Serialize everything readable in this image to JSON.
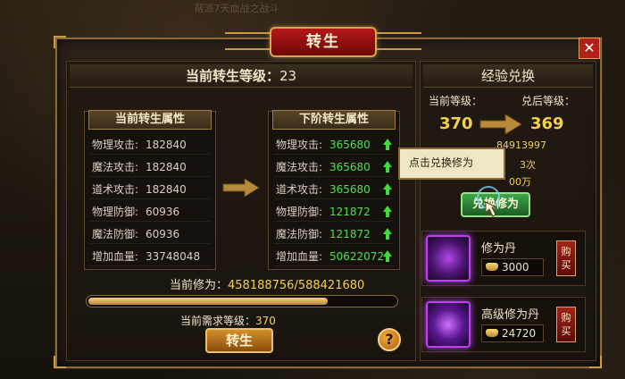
{
  "background": {
    "banner": "帮派7天血战之战斗"
  },
  "window": {
    "title": "转生",
    "close": "✕"
  },
  "left": {
    "level_label": "当前转生等级：",
    "level_value": "23",
    "current_title": "当前转生属性",
    "next_title": "下阶转生属性",
    "current": [
      {
        "label": "物理攻击:",
        "value": "182840"
      },
      {
        "label": "魔法攻击:",
        "value": "182840"
      },
      {
        "label": "道术攻击:",
        "value": "182840"
      },
      {
        "label": "物理防御:",
        "value": "60936"
      },
      {
        "label": "魔法防御:",
        "value": "60936"
      },
      {
        "label": "增加血量:",
        "value": "33748048"
      }
    ],
    "next": [
      {
        "label": "物理攻击:",
        "value": "365680"
      },
      {
        "label": "魔法攻击:",
        "value": "365680"
      },
      {
        "label": "道术攻击:",
        "value": "365680"
      },
      {
        "label": "物理防御:",
        "value": "121872"
      },
      {
        "label": "魔法防御:",
        "value": "121872"
      },
      {
        "label": "增加血量:",
        "value": "50622072"
      }
    ],
    "cultivation_label": "当前修为：",
    "cultivation_value": "458188756/588421680",
    "progress_fraction": 0.7787,
    "req_level_label": "当前需求等级：",
    "req_level_value": "370",
    "rebirth_button": "转生",
    "help_button": "?"
  },
  "right": {
    "title": "经验兑换",
    "current_level_label": "当前等级：",
    "after_level_label": "兑后等级：",
    "current_level": "370",
    "after_level": "369",
    "partial_exp": "84913997",
    "partial_count": "3次",
    "partial_amount": "00万",
    "tooltip": "点击兑换修为",
    "exchange_button": "兑换修为",
    "items": [
      {
        "name": "修为丹",
        "price": "3000",
        "buy": "购买"
      },
      {
        "name": "高级修为丹",
        "price": "24720",
        "buy": "购买"
      }
    ]
  },
  "colors": {
    "accent_gold": "#f2d24a",
    "increase_green": "#4ee04e",
    "title_red": "#b51818"
  }
}
